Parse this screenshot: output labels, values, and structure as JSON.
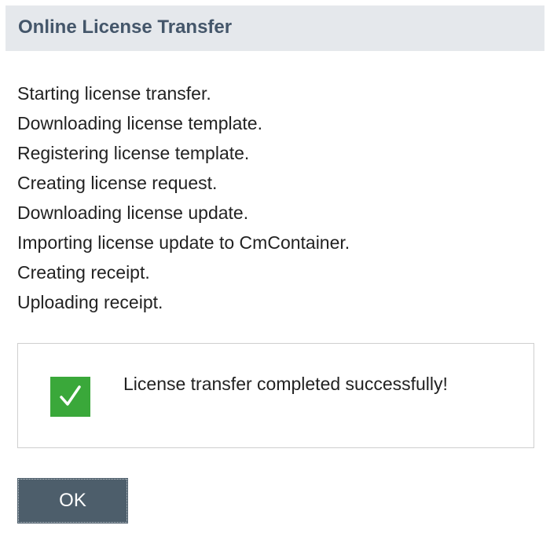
{
  "dialog": {
    "title": "Online License Transfer",
    "log_lines": [
      "Starting license transfer.",
      "Downloading license template.",
      "Registering license template.",
      "Creating license request.",
      "Downloading license update.",
      "Importing license update to CmContainer.",
      "Creating receipt.",
      "Uploading receipt."
    ],
    "result": {
      "icon": "checkmark-icon",
      "icon_color": "#3aa83a",
      "message": "License transfer completed successfully!"
    },
    "ok_button_label": "OK"
  },
  "colors": {
    "header_background": "#e5e8ec",
    "header_text": "#44566a",
    "button_background": "#4d5e6b"
  }
}
